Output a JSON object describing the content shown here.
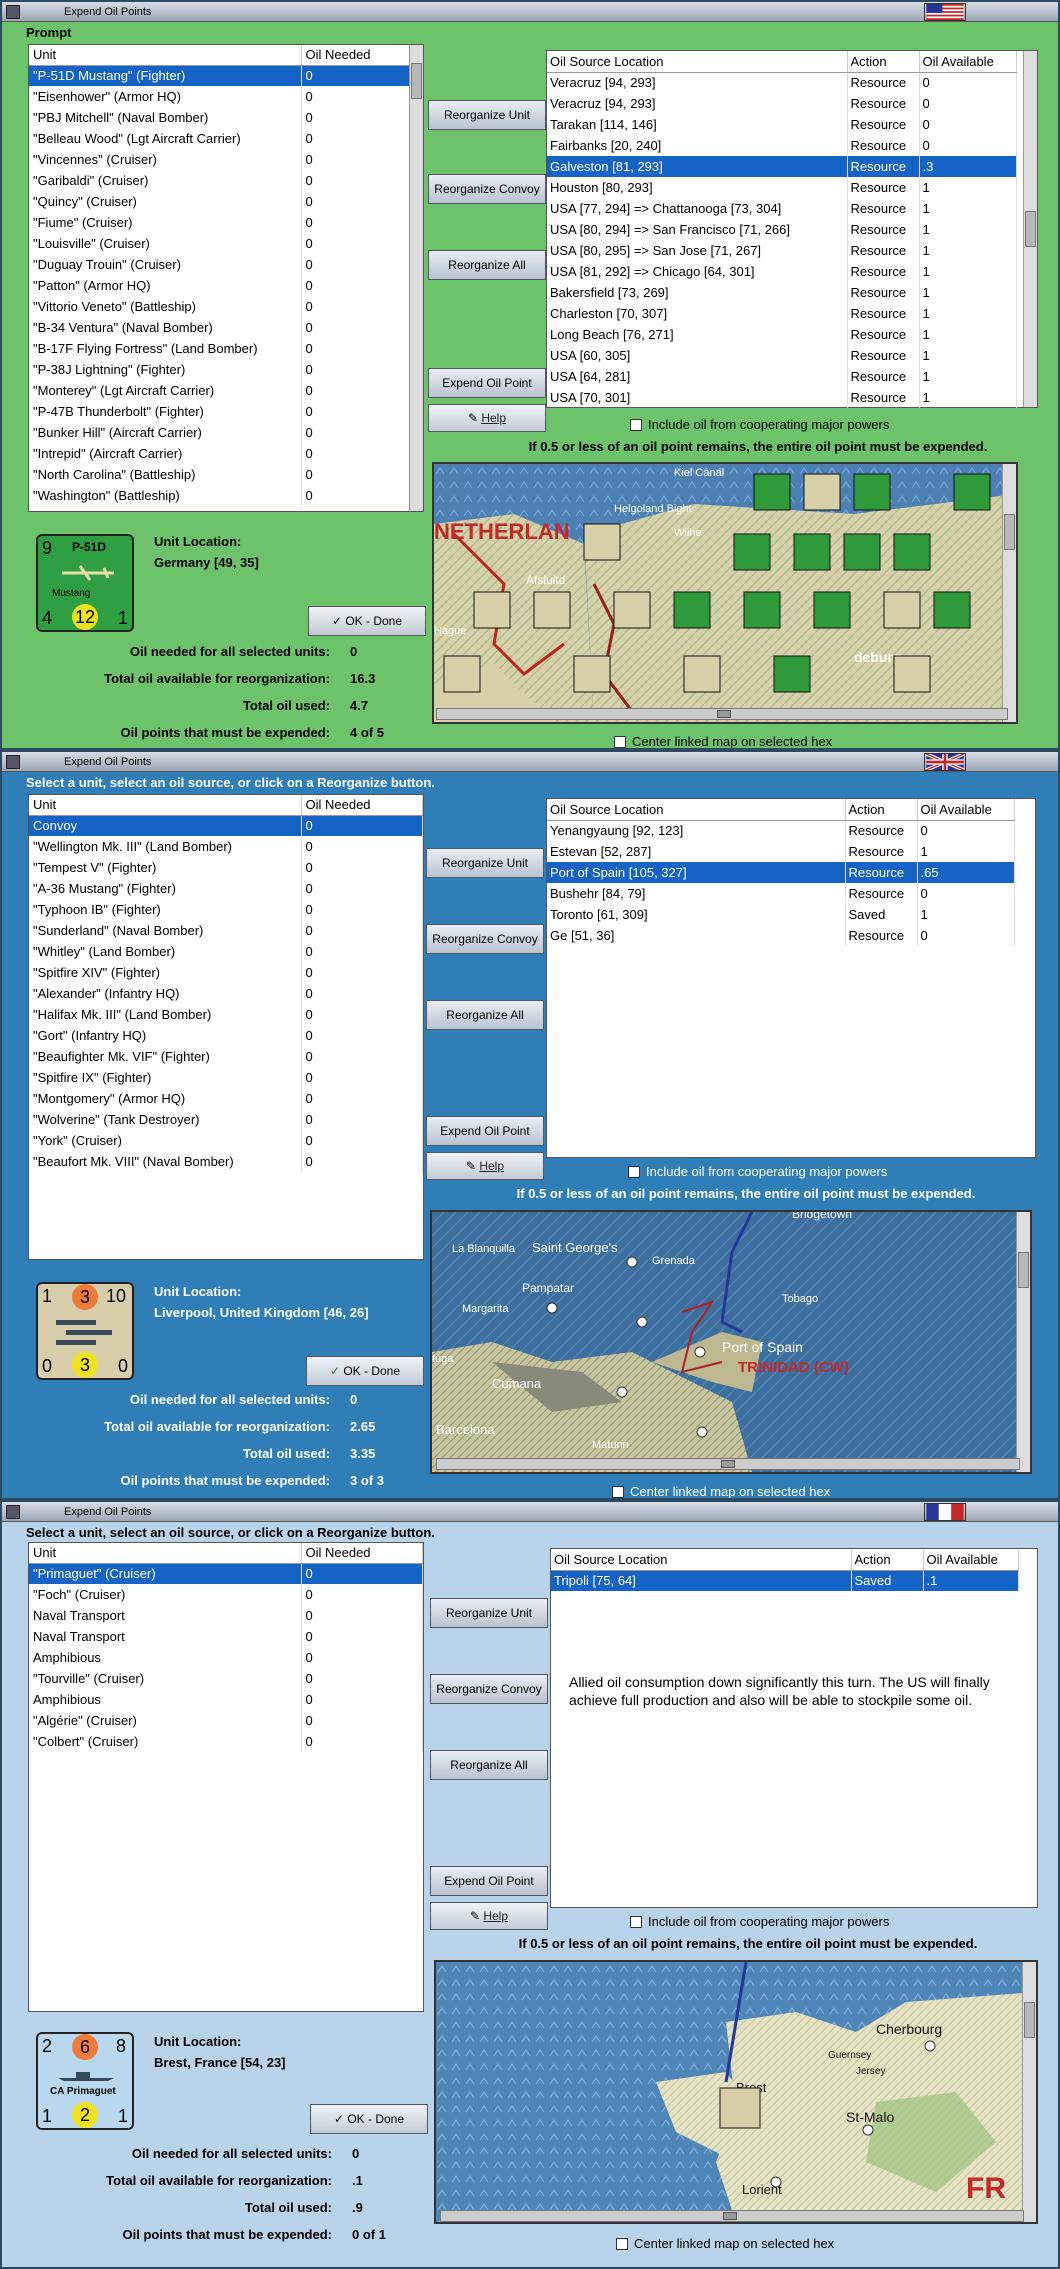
{
  "p1": {
    "title": "Expend Oil Points",
    "prompt": "Prompt",
    "unit_header": [
      "Unit",
      "Oil Needed"
    ],
    "units": [
      [
        "\"P-51D Mustang\" (Fighter)",
        "0"
      ],
      [
        "\"Eisenhower\" (Armor HQ)",
        "0"
      ],
      [
        "\"PBJ Mitchell\" (Naval Bomber)",
        "0"
      ],
      [
        "\"Belleau Wood\" (Lgt Aircraft Carrier)",
        "0"
      ],
      [
        "\"Vincennes\" (Cruiser)",
        "0"
      ],
      [
        "\"Garibaldi\" (Cruiser)",
        "0"
      ],
      [
        "\"Quincy\" (Cruiser)",
        "0"
      ],
      [
        "\"Fiume\" (Cruiser)",
        "0"
      ],
      [
        "\"Louisville\" (Cruiser)",
        "0"
      ],
      [
        "\"Duguay Trouin\" (Cruiser)",
        "0"
      ],
      [
        "\"Patton\" (Armor HQ)",
        "0"
      ],
      [
        "\"Vittorio Veneto\" (Battleship)",
        "0"
      ],
      [
        "\"B-34 Ventura\" (Naval Bomber)",
        "0"
      ],
      [
        "\"B-17F Flying Fortress\" (Land Bomber)",
        "0"
      ],
      [
        "\"P-38J Lightning\" (Fighter)",
        "0"
      ],
      [
        "\"Monterey\" (Lgt Aircraft Carrier)",
        "0"
      ],
      [
        "\"P-47B Thunderbolt\" (Fighter)",
        "0"
      ],
      [
        "\"Bunker Hill\" (Aircraft Carrier)",
        "0"
      ],
      [
        "\"Intrepid\" (Aircraft Carrier)",
        "0"
      ],
      [
        "\"North Carolina\" (Battleship)",
        "0"
      ],
      [
        "\"Washington\" (Battleship)",
        "0"
      ]
    ],
    "src_header": [
      "Oil Source Location",
      "Action",
      "Oil Available"
    ],
    "sources": [
      [
        "Veracruz [94, 293]",
        "Resource",
        "0"
      ],
      [
        "Veracruz [94, 293]",
        "Resource",
        "0"
      ],
      [
        "Tarakan [114, 146]",
        "Resource",
        "0"
      ],
      [
        "Fairbanks [20, 240]",
        "Resource",
        "0"
      ],
      [
        "Galveston [81, 293]",
        "Resource",
        ".3"
      ],
      [
        "Houston [80, 293]",
        "Resource",
        "1"
      ],
      [
        "USA [77, 294] => Chattanooga [73, 304]",
        "Resource",
        "1"
      ],
      [
        "USA [80, 294] => San Francisco [71, 266]",
        "Resource",
        "1"
      ],
      [
        "USA [80, 295] => San Jose [71, 267]",
        "Resource",
        "1"
      ],
      [
        "USA [81, 292] => Chicago [64, 301]",
        "Resource",
        "1"
      ],
      [
        "Bakersfield [73, 269]",
        "Resource",
        "1"
      ],
      [
        "Charleston [70, 307]",
        "Resource",
        "1"
      ],
      [
        "Long Beach [76, 271]",
        "Resource",
        "1"
      ],
      [
        "USA [60, 305]",
        "Resource",
        "1"
      ],
      [
        "USA [64, 281]",
        "Resource",
        "1"
      ],
      [
        "USA [70, 301]",
        "Resource",
        "1"
      ]
    ],
    "buttons": [
      "Reorganize Unit",
      "Reorganize Convoy",
      "Reorganize All",
      "Expend Oil Point"
    ],
    "help": "Help",
    "include": "Include oil from cooperating major powers",
    "warn": "If 0.5 or less of an oil point remains, the entire oil point must be expended.",
    "center": "Center linked map on selected hex",
    "counter": {
      "tl": "9",
      "name": "P-51D",
      "sub": "Mustang",
      "bl": "4",
      "bm": "12",
      "br": "1"
    },
    "loc_label": "Unit Location:",
    "loc": "Germany [49, 35]",
    "ok": "OK - Done",
    "stats": [
      [
        "Oil needed for all selected units:",
        "0"
      ],
      [
        "Total oil available for reorganization:",
        "16.3"
      ],
      [
        "Total oil used:",
        "4.7"
      ],
      [
        "Oil points that must be expended:",
        "4 of 5"
      ]
    ],
    "map_labels": [
      "NETHERLAN",
      "Helgoland Bight",
      "Kiel Canal",
      "Afsluitd",
      "Wilhe",
      "Hague",
      "deburg"
    ]
  },
  "p2": {
    "title": "Expend Oil Points",
    "prompt": "Select a unit, select an oil source, or click on a Reorganize button.",
    "unit_header": [
      "Unit",
      "Oil Needed"
    ],
    "units": [
      [
        "Convoy",
        "0"
      ],
      [
        "\"Wellington Mk. III\" (Land Bomber)",
        "0"
      ],
      [
        "\"Tempest V\" (Fighter)",
        "0"
      ],
      [
        "\"A-36 Mustang\" (Fighter)",
        "0"
      ],
      [
        "\"Typhoon IB\" (Fighter)",
        "0"
      ],
      [
        "\"Sunderland\" (Naval Bomber)",
        "0"
      ],
      [
        "\"Whitley\" (Land Bomber)",
        "0"
      ],
      [
        "\"Spitfire XIV\" (Fighter)",
        "0"
      ],
      [
        "\"Alexander\" (Infantry HQ)",
        "0"
      ],
      [
        "\"Halifax Mk. III\" (Land Bomber)",
        "0"
      ],
      [
        "\"Gort\" (Infantry HQ)",
        "0"
      ],
      [
        "\"Beaufighter Mk. VIF\" (Fighter)",
        "0"
      ],
      [
        "\"Spitfire IX\" (Fighter)",
        "0"
      ],
      [
        "\"Montgomery\" (Armor HQ)",
        "0"
      ],
      [
        "\"Wolverine\" (Tank Destroyer)",
        "0"
      ],
      [
        "\"York\" (Cruiser)",
        "0"
      ],
      [
        "\"Beaufort Mk. VIII\" (Naval Bomber)",
        "0"
      ]
    ],
    "src_header": [
      "Oil Source Location",
      "Action",
      "Oil Available"
    ],
    "sources": [
      [
        "Yenangyaung [92, 123]",
        "Resource",
        "0"
      ],
      [
        "Estevan [52, 287]",
        "Resource",
        "1"
      ],
      [
        "Port of Spain [105, 327]",
        "Resource",
        ".65"
      ],
      [
        "Bushehr [84, 79]",
        "Resource",
        "0"
      ],
      [
        "Toronto [61, 309]",
        "Saved",
        "1"
      ],
      [
        "Ge [51, 36]",
        "Resource",
        "0"
      ]
    ],
    "buttons": [
      "Reorganize Unit",
      "Reorganize Convoy",
      "Reorganize All",
      "Expend Oil Point"
    ],
    "help": "Help",
    "include": "Include oil from cooperating major powers",
    "warn": "If 0.5 or less of an oil point remains, the entire oil point must be expended.",
    "center": "Center linked map on selected hex",
    "counter": {
      "tl": "1",
      "tm": "3",
      "tr": "10",
      "bl": "0",
      "bm": "3",
      "br": "0"
    },
    "loc_label": "Unit Location:",
    "loc": "Liverpool, United Kingdom [46, 26]",
    "ok": "OK - Done",
    "stats": [
      [
        "Oil needed for all selected units:",
        "0"
      ],
      [
        "Total oil available for reorganization:",
        "2.65"
      ],
      [
        "Total oil used:",
        "3.35"
      ],
      [
        "Oil points that must be expended:",
        "3 of 3"
      ]
    ],
    "map_labels": [
      "Bridgetown",
      "La Blanquilla",
      "Saint George's",
      "Grenada",
      "Pampatar",
      "Margarita",
      "Tobago",
      "Port of Spain",
      "TRINIDAD (CW)",
      "Cumana",
      "Barcelona",
      "Maturin",
      "tuga"
    ]
  },
  "p3": {
    "title": "Expend Oil Points",
    "prompt": "Select a unit, select an oil source, or click on a Reorganize button.",
    "unit_header": [
      "Unit",
      "Oil Needed"
    ],
    "units": [
      [
        "\"Primaguet\" (Cruiser)",
        "0"
      ],
      [
        "\"Foch\" (Cruiser)",
        "0"
      ],
      [
        "Naval Transport",
        "0"
      ],
      [
        "Naval Transport",
        "0"
      ],
      [
        "Amphibious",
        "0"
      ],
      [
        "\"Tourville\" (Cruiser)",
        "0"
      ],
      [
        "Amphibious",
        "0"
      ],
      [
        "\"Algérie\" (Cruiser)",
        "0"
      ],
      [
        "\"Colbert\" (Cruiser)",
        "0"
      ]
    ],
    "src_header": [
      "Oil Source Location",
      "Action",
      "Oil Available"
    ],
    "sources": [
      [
        "Tripoli [75, 64]",
        "Saved",
        ".1"
      ]
    ],
    "note": "Allied oil consumption down significantly this turn.  The US will finally achieve full production and also will be able to stockpile some oil.",
    "buttons": [
      "Reorganize Unit",
      "Reorganize Convoy",
      "Reorganize All",
      "Expend Oil Point"
    ],
    "help": "Help",
    "include": "Include oil from cooperating major powers",
    "warn": "If 0.5 or less of an oil point remains, the entire oil point must be expended.",
    "center": "Center linked map on selected hex",
    "counter": {
      "tl": "2",
      "tm": "6",
      "tr": "8",
      "name": "CA Primaguet",
      "bl": "1",
      "bm": "2",
      "br": "1"
    },
    "loc_label": "Unit Location:",
    "loc": "Brest, France [54, 23]",
    "ok": "OK - Done",
    "stats": [
      [
        "Oil needed for all selected units:",
        "0"
      ],
      [
        "Total oil available for reorganization:",
        ".1"
      ],
      [
        "Total oil used:",
        ".9"
      ],
      [
        "Oil points that must be expended:",
        "0 of 1"
      ]
    ],
    "map_labels": [
      "Cherbourg",
      "Guernsey",
      "Jersey",
      "Brest",
      "St-Malo",
      "Lorient",
      "FR"
    ]
  }
}
